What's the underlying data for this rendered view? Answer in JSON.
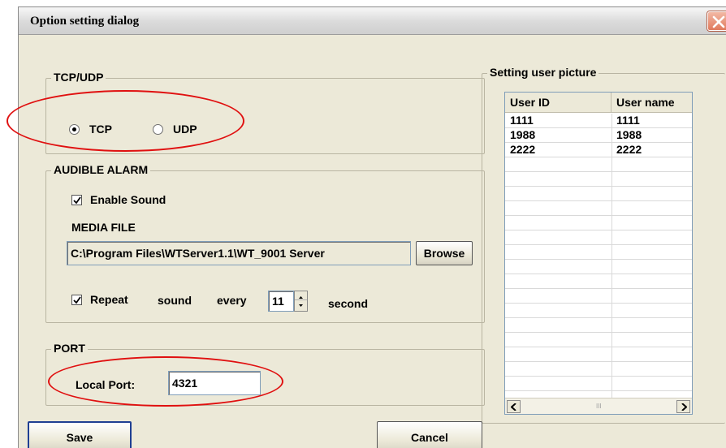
{
  "dialog": {
    "title": "Option setting dialog",
    "close_icon": "close-icon"
  },
  "tcp_udp": {
    "group_label": "TCP/UDP",
    "options": [
      "TCP",
      "UDP"
    ],
    "selected": "TCP"
  },
  "audible_alarm": {
    "group_label": "AUDIBLE ALARM",
    "enable_sound_label": "Enable Sound",
    "enable_sound_checked": true,
    "media_file_label": "MEDIA FILE",
    "media_file_path": "C:\\Program Files\\WTServer1.1\\WT_9001 Server",
    "browse_label": "Browse",
    "repeat_checked": true,
    "repeat_label": "Repeat",
    "sound_label": "sound",
    "every_label": "every",
    "repeat_seconds": "11",
    "second_label": "second"
  },
  "port": {
    "group_label": "PORT",
    "local_port_label": "Local Port:",
    "local_port_value": "4321"
  },
  "user_picture": {
    "group_label": "Setting user picture",
    "columns": [
      "User ID",
      "User name"
    ],
    "rows": [
      [
        "1111",
        "1111"
      ],
      [
        "1988",
        "1988"
      ],
      [
        "2222",
        "2222"
      ]
    ],
    "scroll_grip": "III"
  },
  "buttons": {
    "save_label": "Save",
    "cancel_label": "Cancel"
  },
  "colors": {
    "annotation_ellipse": "#e01010",
    "dialog_bg": "#ece9d8"
  }
}
